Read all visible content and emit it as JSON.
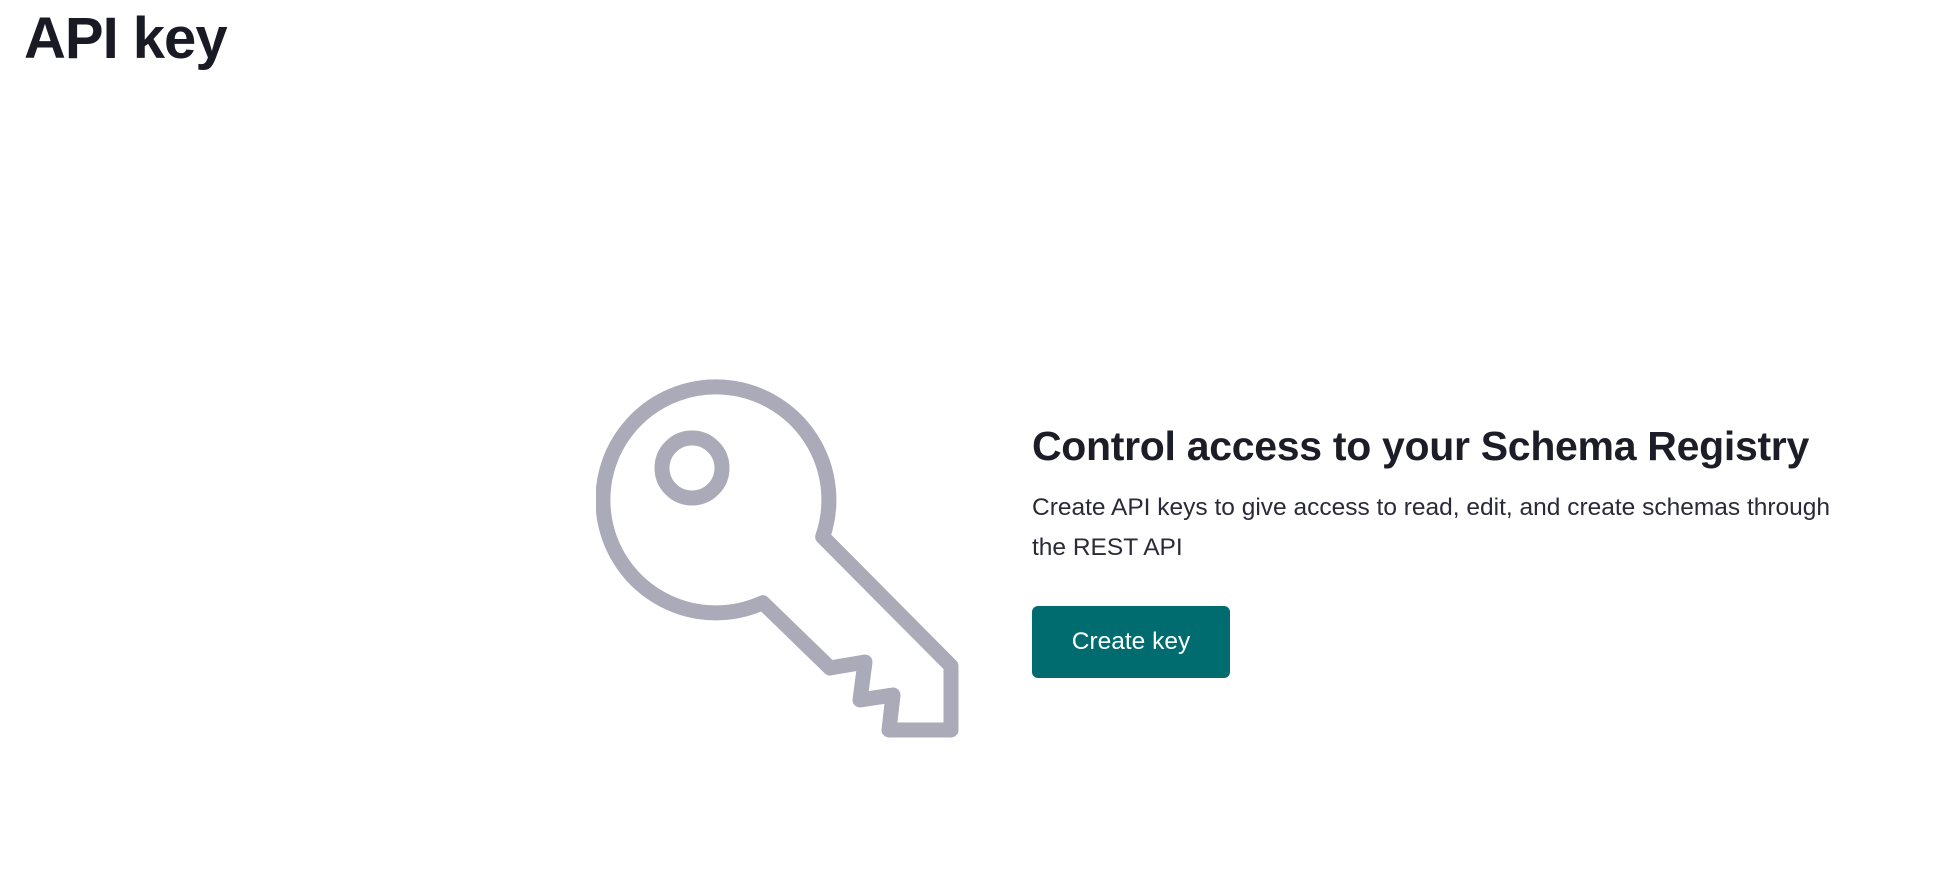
{
  "header": {
    "title": "API key"
  },
  "empty_state": {
    "icon": "key-icon",
    "heading": "Control access to your Schema Registry",
    "description": "Create API keys to give access to read, edit, and create schemas through the REST API",
    "button_label": "Create key"
  },
  "colors": {
    "primary_button": "#006c70",
    "icon": "#aaaab9",
    "text": "#1d1d28"
  }
}
